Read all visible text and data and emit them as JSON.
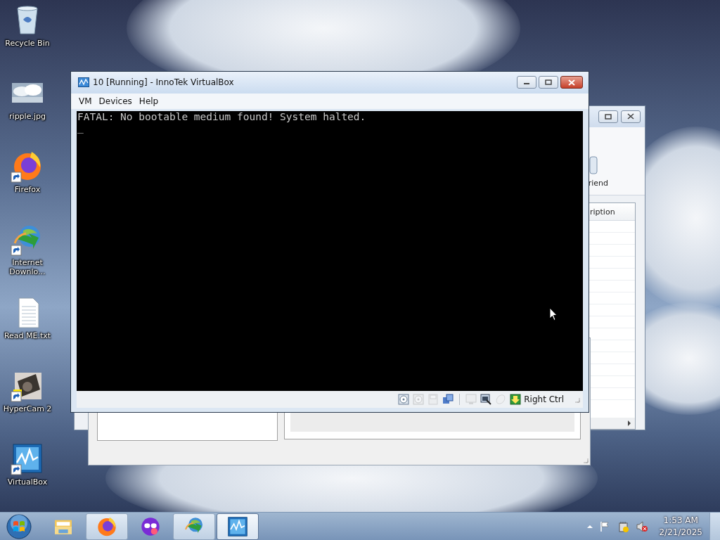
{
  "desktop_icons": [
    {
      "label": "Recycle Bin",
      "kind": "recycle",
      "shortcut": false
    },
    {
      "label": "ripple.jpg",
      "kind": "image",
      "shortcut": false
    },
    {
      "label": "Firefox",
      "kind": "firefox",
      "shortcut": true
    },
    {
      "label": "Internet Downlo...",
      "kind": "idm",
      "shortcut": true
    },
    {
      "label": "Read ME.txt",
      "kind": "text",
      "shortcut": false
    },
    {
      "label": "HyperCam 2",
      "kind": "camera",
      "shortcut": true
    },
    {
      "label": "VirtualBox",
      "kind": "vbox",
      "shortcut": true
    }
  ],
  "manager_window": {
    "toolbar_label": "riend",
    "column_header": "ription"
  },
  "vm_window": {
    "title": "10 [Running] - InnoTek VirtualBox",
    "menu": [
      "VM",
      "Devices",
      "Help"
    ],
    "console_lines": [
      "FATAL: No bootable medium found! System halted.",
      "_"
    ],
    "status_icons": [
      {
        "kind": "disc",
        "disabled": false
      },
      {
        "kind": "cd",
        "disabled": true
      },
      {
        "kind": "floppy",
        "disabled": true
      },
      {
        "kind": "network",
        "disabled": false
      },
      {
        "kind": "separator"
      },
      {
        "kind": "display",
        "disabled": true
      },
      {
        "kind": "window",
        "disabled": false
      },
      {
        "kind": "mouse",
        "disabled": true
      },
      {
        "kind": "hostkey",
        "disabled": false
      }
    ],
    "host_key": "Right Ctrl"
  },
  "taskbar": {
    "buttons": [
      {
        "kind": "explorer",
        "running": false,
        "selected": false
      },
      {
        "kind": "firefox",
        "running": true,
        "selected": false
      },
      {
        "kind": "mask",
        "running": false,
        "selected": false
      },
      {
        "kind": "idm",
        "running": true,
        "selected": false
      },
      {
        "kind": "vbox",
        "running": true,
        "selected": true
      }
    ],
    "time": "1:53 AM",
    "date": "2/21/2025"
  }
}
